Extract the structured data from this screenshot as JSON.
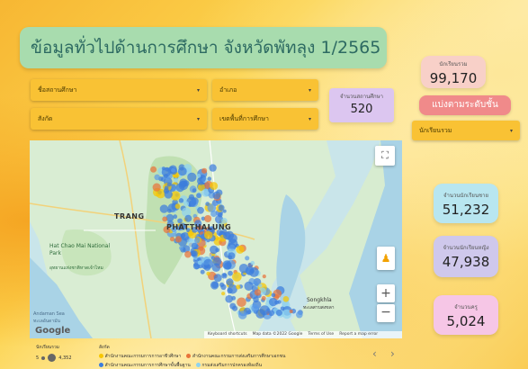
{
  "title": "ข้อมูลทั่วไปด้านการศึกษา จังหวัดพัทลุง 1/2565",
  "filters": {
    "school_name": "ชื่อสถานศึกษา",
    "district": "อำเภอ",
    "affiliation": "สังกัด",
    "service_area": "เขตพื้นที่การศึกษา"
  },
  "school_count": {
    "label": "จำนวนสถานศึกษา",
    "value": "520"
  },
  "total_students": {
    "label": "นักเรียนรวม",
    "value": "99,170"
  },
  "split_by_level_button": "แบ่งตามระดับชั้น",
  "level_select": "นักเรียนรวม",
  "male_students": {
    "label": "จำนวนนักเรียนชาย",
    "value": "51,232"
  },
  "female_students": {
    "label": "จำนวนนักเรียนหญิง",
    "value": "47,938"
  },
  "teachers": {
    "label": "จำนวนครู",
    "value": "5,024"
  },
  "map": {
    "places": {
      "trang": "TRANG",
      "phatthalung": "PHATTHALUNG",
      "hat_chao_mai": "Hat Chao Mai National Park",
      "hat_chao_mai_th": "อุทยานแห่งชาติหาดเจ้าไหม",
      "songkhla": "Songkhla",
      "songkhla_th": "ทะเลสาบสงขลา",
      "andaman": "Andaman Sea",
      "andaman_th": "ทะเลอันดามัน"
    },
    "google_logo": "Google",
    "attribution": {
      "shortcuts": "Keyboard shortcuts",
      "map_data": "Map data ©2022 Google",
      "terms": "Terms of Use",
      "report": "Report a map error"
    },
    "zoom_in": "+",
    "zoom_out": "−",
    "fullscreen_icon": "fullscreen-icon",
    "pegman_icon": "pegman-icon"
  },
  "legend": {
    "size_title": "นักเรียนรวม",
    "size_min": "5",
    "size_max": "4,352",
    "color_title": "สังกัด",
    "items": [
      {
        "label": "สำนักงานคณะกรรมการการอาชีวศึกษา",
        "color": "#f7c600"
      },
      {
        "label": "สำนักงานคณะกรรมการส่งเสริมการศึกษาเอกชน",
        "color": "#e8733a"
      },
      {
        "label": "สำนักงานคณะกรรมการการศึกษาขั้นพื้นฐาน",
        "color": "#3b7ddd"
      },
      {
        "label": "กรมส่งเสริมการปกครองท้องถิ่น",
        "color": "#8fd3f0"
      }
    ]
  },
  "pager": {
    "prev": "‹",
    "next": "›"
  },
  "colors": {
    "title_bg": "#a8dcae",
    "dropdown": "#f9c234",
    "school_count_bg": "#dcc6f0",
    "total_bg": "#f8d0c8",
    "split_btn_bg": "#f08a8a",
    "male_bg": "#b8e6f0",
    "female_bg": "#cfc8ec",
    "teacher_bg": "#f6c6e6"
  }
}
